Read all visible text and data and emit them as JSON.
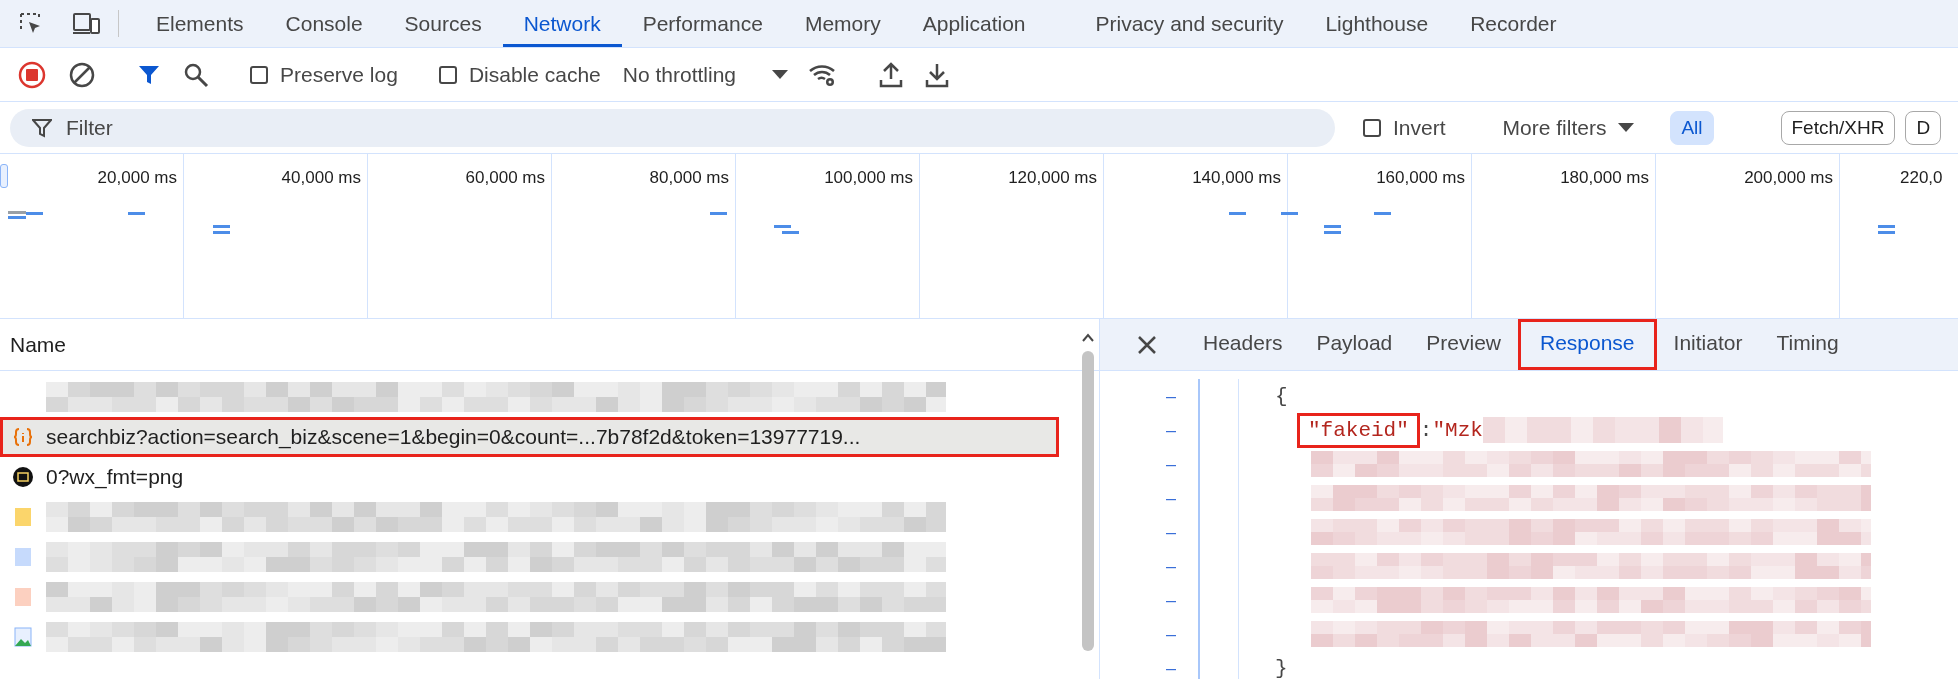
{
  "panel_tabs": [
    {
      "label": "Elements",
      "selected": false
    },
    {
      "label": "Console",
      "selected": false
    },
    {
      "label": "Sources",
      "selected": false
    },
    {
      "label": "Network",
      "selected": true
    },
    {
      "label": "Performance",
      "selected": false
    },
    {
      "label": "Memory",
      "selected": false
    },
    {
      "label": "Application",
      "selected": false
    },
    {
      "label": "Privacy and security",
      "selected": false
    },
    {
      "label": "Lighthouse",
      "selected": false
    },
    {
      "label": "Recorder",
      "selected": false
    }
  ],
  "toolbar": {
    "recording": true,
    "filter_active": true,
    "preserve_log": {
      "label": "Preserve log",
      "checked": false
    },
    "disable_cache": {
      "label": "Disable cache",
      "checked": false
    },
    "throttling": "No throttling"
  },
  "filter_bar": {
    "placeholder": "Filter",
    "invert": {
      "label": "Invert",
      "checked": false
    },
    "more_filters": "More filters",
    "types": [
      {
        "label": "All",
        "selected": true
      },
      {
        "label": "Fetch/XHR",
        "selected": false
      },
      {
        "label": "D",
        "selected": false
      }
    ]
  },
  "timeline": {
    "ticks": [
      "20,000 ms",
      "40,000 ms",
      "60,000 ms",
      "80,000 ms",
      "100,000 ms",
      "120,000 ms",
      "140,000 ms",
      "160,000 ms",
      "180,000 ms",
      "200,000 ms",
      "220,0"
    ]
  },
  "requests": {
    "column": "Name",
    "rows": [
      {
        "kind": "blank",
        "selected": false,
        "highlighted": false
      },
      {
        "kind": "fetch",
        "name": "searchbiz?action=search_biz&scene=1&begin=0&count=...7b78f2d&token=13977719...",
        "selected": true,
        "highlighted": true
      },
      {
        "kind": "image",
        "name": "0?wx_fmt=png",
        "selected": false,
        "highlighted": false
      },
      {
        "kind": "script",
        "selected": false,
        "highlighted": false
      },
      {
        "kind": "document",
        "selected": false,
        "highlighted": false
      },
      {
        "kind": "font",
        "selected": false,
        "highlighted": false
      },
      {
        "kind": "picture",
        "selected": false,
        "highlighted": false
      }
    ]
  },
  "detail": {
    "tabs": [
      {
        "label": "Headers",
        "selected": false,
        "highlighted": false
      },
      {
        "label": "Payload",
        "selected": false,
        "highlighted": false
      },
      {
        "label": "Preview",
        "selected": false,
        "highlighted": false
      },
      {
        "label": "Response",
        "selected": true,
        "highlighted": true
      },
      {
        "label": "Initiator",
        "selected": false,
        "highlighted": false
      },
      {
        "label": "Timing",
        "selected": false,
        "highlighted": false
      }
    ],
    "object": {
      "marker": "–",
      "open": "{",
      "close_marker": "–",
      "close": "}",
      "children": [
        {
          "kind": "pair",
          "marker": "–",
          "key": "\"fakeid\"",
          "sep": ": ",
          "value": "\"Mzk",
          "key_highlighted": true
        },
        {
          "kind": "redacted",
          "marker": "–"
        },
        {
          "kind": "redacted",
          "marker": "–"
        },
        {
          "kind": "redacted",
          "marker": "–"
        },
        {
          "kind": "redacted",
          "marker": "–"
        },
        {
          "kind": "redacted",
          "marker": "–"
        },
        {
          "kind": "redacted",
          "marker": "–"
        }
      ]
    }
  }
}
